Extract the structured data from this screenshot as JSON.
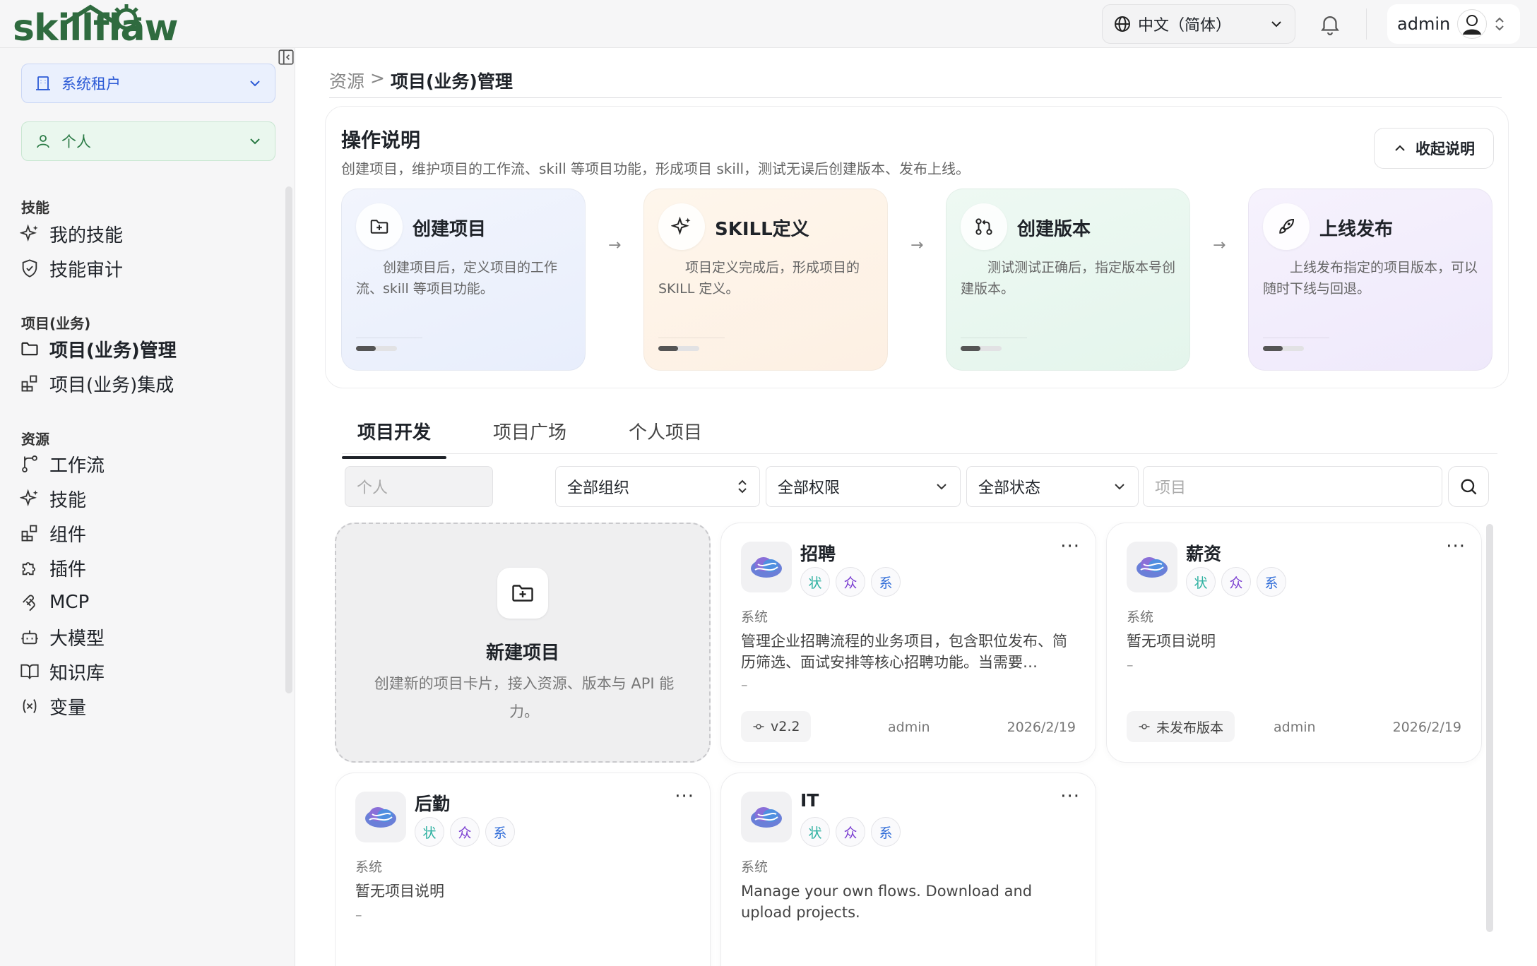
{
  "app": {
    "logo_text": "skillflaw"
  },
  "topbar": {
    "language": "中文（简体）",
    "username": "admin"
  },
  "sidebar": {
    "tenant": "系统租户",
    "scope": "个人",
    "sections": [
      {
        "title": "技能",
        "items": [
          {
            "label": "我的技能",
            "icon": "sparkles-icon"
          },
          {
            "label": "技能审计",
            "icon": "shield-icon"
          }
        ]
      },
      {
        "title": "项目(业务)",
        "items": [
          {
            "label": "项目(业务)管理",
            "icon": "folder-icon",
            "active": true
          },
          {
            "label": "项目(业务)集成",
            "icon": "blocks-icon"
          }
        ]
      },
      {
        "title": "资源",
        "items": [
          {
            "label": "工作流",
            "icon": "workflow-icon"
          },
          {
            "label": "技能",
            "icon": "sparkles-icon"
          },
          {
            "label": "组件",
            "icon": "blocks-icon"
          },
          {
            "label": "插件",
            "icon": "puzzle-icon"
          },
          {
            "label": "MCP",
            "icon": "mcp-icon"
          },
          {
            "label": "大模型",
            "icon": "bot-icon"
          },
          {
            "label": "知识库",
            "icon": "book-icon"
          },
          {
            "label": "变量",
            "icon": "variable-icon"
          }
        ]
      }
    ]
  },
  "breadcrumb": {
    "parent": "资源",
    "sep": ">",
    "current": "项目(业务)管理"
  },
  "guide": {
    "title": "操作说明",
    "description": "创建项目，维护项目的工作流、skill 等项目功能，形成项目 skill，测试无误后创建版本、发布上线。",
    "collapse_label": "收起说明",
    "steps": [
      {
        "name": "创建项目",
        "desc": "创建项目后，定义项目的工作流、skill 等项目功能。",
        "icon": "folder-plus-icon",
        "color": "#eef2fd"
      },
      {
        "name": "SKILL定义",
        "desc": "项目定义完成后，形成项目的 SKILL 定义。",
        "icon": "sparkles-icon",
        "color": "#fdf3e8"
      },
      {
        "name": "创建版本",
        "desc": "测试测试正确后，指定版本号创建版本。",
        "icon": "git-pull-request-icon",
        "color": "#eaf7f0"
      },
      {
        "name": "上线发布",
        "desc": "上线发布指定的项目版本，可以随时下线与回退。",
        "icon": "rocket-icon",
        "color": "#f3effc"
      }
    ]
  },
  "tabs": [
    "项目开发",
    "项目广场",
    "个人项目"
  ],
  "filters": {
    "scope": "个人",
    "org": "全部组织",
    "permission": "全部权限",
    "status": "全部状态",
    "search_placeholder": "项目"
  },
  "new_project": {
    "title": "新建项目",
    "desc": "创建新的项目卡片，接入资源、版本与 API 能力。"
  },
  "badges": {
    "status": "状",
    "public": "众",
    "system": "系"
  },
  "projects": [
    {
      "title": "招聘",
      "org": "系统",
      "desc": "管理企业招聘流程的业务项目，包含职位发布、简历筛选、面试安排等核心招聘功能。当需要…",
      "dash": "–",
      "version": "v2.2",
      "owner": "admin",
      "date": "2026/2/19"
    },
    {
      "title": "薪资",
      "org": "系统",
      "desc": "暂无项目说明",
      "dash": "–",
      "version": "未发布版本",
      "owner": "admin",
      "date": "2026/2/19"
    },
    {
      "title": "后勤",
      "org": "系统",
      "desc": "暂无项目说明",
      "dash": "–",
      "version": "",
      "owner": "",
      "date": ""
    },
    {
      "title": "IT",
      "org": "系统",
      "desc": "Manage your own flows. Download and upload projects.",
      "dash": "",
      "version": "",
      "owner": "",
      "date": ""
    }
  ]
}
